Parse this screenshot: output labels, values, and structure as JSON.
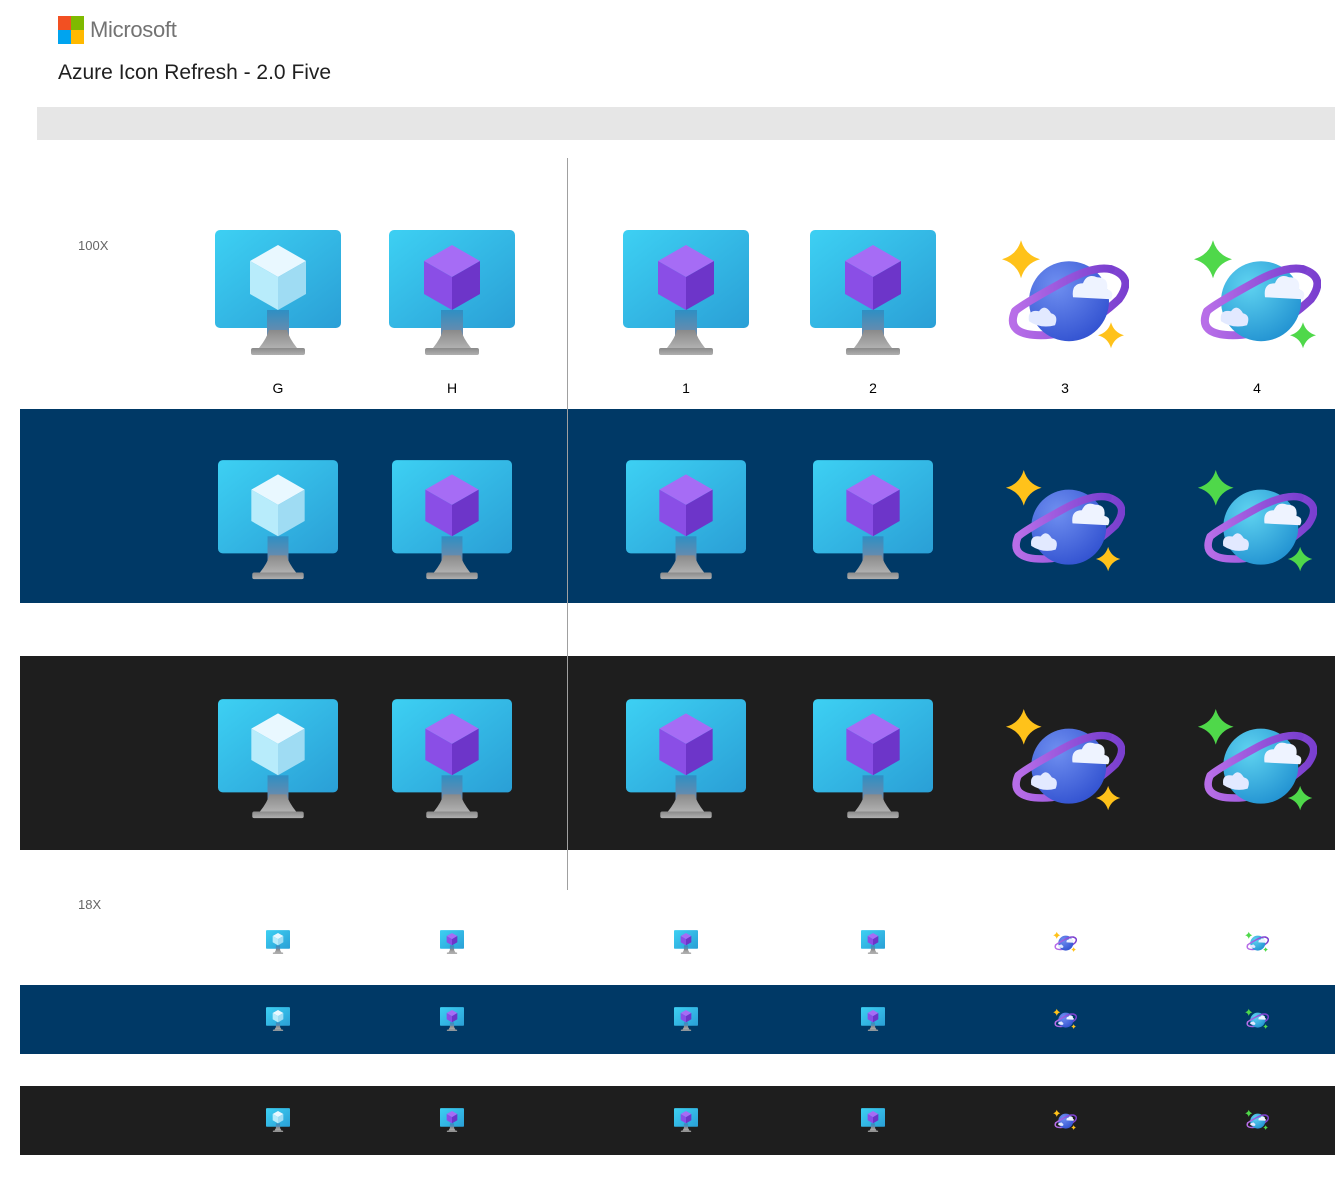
{
  "header": {
    "brand": "Microsoft",
    "title": "Azure Icon Refresh - 2.0 Five"
  },
  "scales": {
    "large": "100X",
    "small": "18X"
  },
  "columns": [
    {
      "label": "G",
      "icon": "vm-icon-light-cube"
    },
    {
      "label": "H",
      "icon": "vm-icon-purple-cube"
    },
    {
      "label": "1",
      "icon": "vm-icon-purple-cube"
    },
    {
      "label": "2",
      "icon": "vm-icon-purple-cube"
    },
    {
      "label": "3",
      "icon": "cosmos-planet-icon-yellow-stars"
    },
    {
      "label": "4",
      "icon": "cosmos-planet-icon-green-stars"
    }
  ],
  "colors": {
    "navy_band": "#003966",
    "dark_band": "#1e1e1e",
    "grey_bar": "#e6e6e6",
    "ms_red": "#f25022",
    "ms_green": "#7fba00",
    "ms_blue": "#00a4ef",
    "ms_yellow": "#ffb900"
  }
}
